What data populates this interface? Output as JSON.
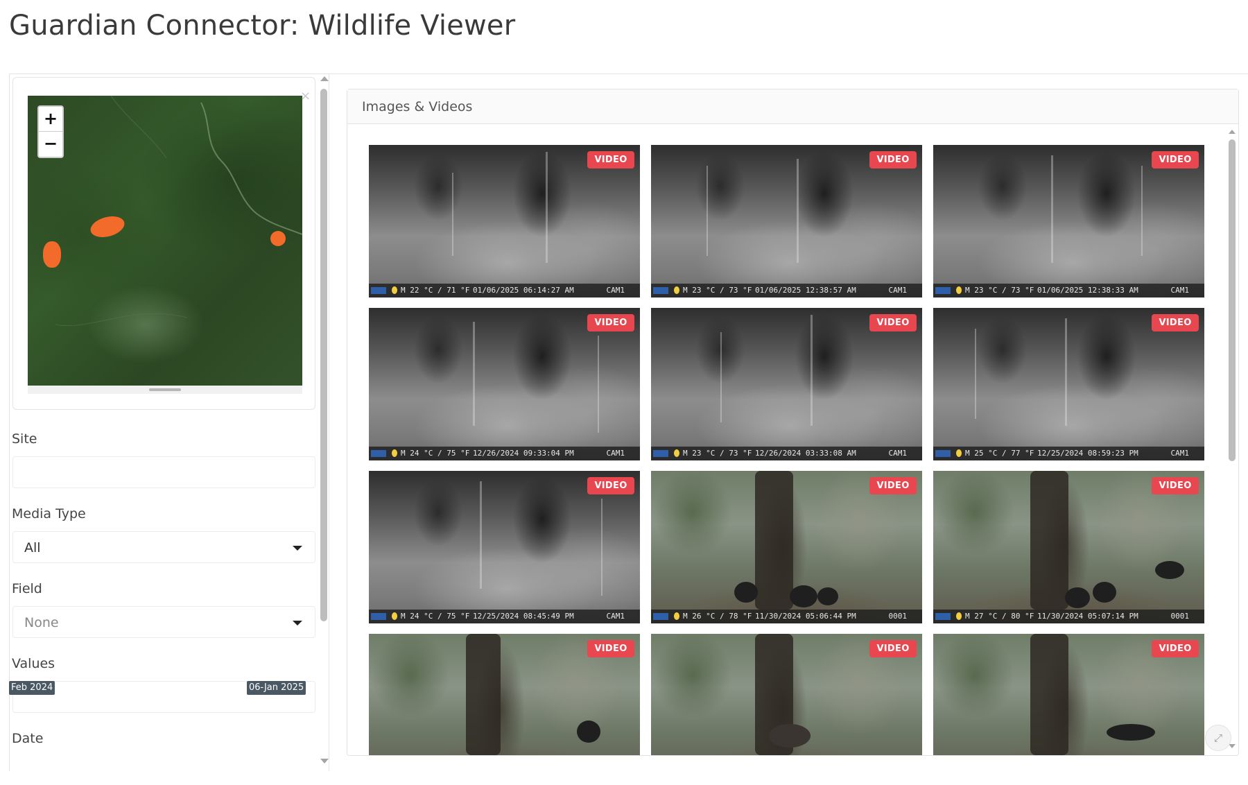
{
  "page": {
    "title": "Guardian Connector: Wildlife Viewer"
  },
  "map": {
    "zoom_in": "+",
    "zoom_out": "−",
    "close": "×",
    "marker_color": "#f26b2a"
  },
  "filters": {
    "site": {
      "label": "Site",
      "value": ""
    },
    "media_type": {
      "label": "Media Type",
      "value": "All"
    },
    "field": {
      "label": "Field",
      "value": "None"
    },
    "values": {
      "label": "Values",
      "value": ""
    },
    "date": {
      "label": "Date",
      "start": "Feb 2024",
      "end": "06-Jan 2025"
    }
  },
  "media": {
    "title": "Images & Videos",
    "badge_color": "#e8474f",
    "items": [
      {
        "badge": "VIDEO",
        "temp": "M 22 °C / 71 °F",
        "datetime": "01/06/2025 06:14:27 AM",
        "camera": "CAM1",
        "scene": "infrared"
      },
      {
        "badge": "VIDEO",
        "temp": "M 23 °C / 73 °F",
        "datetime": "01/06/2025 12:38:57 AM",
        "camera": "CAM1",
        "scene": "infrared"
      },
      {
        "badge": "VIDEO",
        "temp": "M 23 °C / 73 °F",
        "datetime": "01/06/2025 12:38:33 AM",
        "camera": "CAM1",
        "scene": "infrared"
      },
      {
        "badge": "VIDEO",
        "temp": "M 24 °C / 75 °F",
        "datetime": "12/26/2024 09:33:04 PM",
        "camera": "CAM1",
        "scene": "infrared"
      },
      {
        "badge": "VIDEO",
        "temp": "M 23 °C / 73 °F",
        "datetime": "12/26/2024 03:33:08 AM",
        "camera": "CAM1",
        "scene": "infrared"
      },
      {
        "badge": "VIDEO",
        "temp": "M 25 °C / 77 °F",
        "datetime": "12/25/2024 08:59:23 PM",
        "camera": "CAM1",
        "scene": "infrared"
      },
      {
        "badge": "VIDEO",
        "temp": "M 24 °C / 75 °F",
        "datetime": "12/25/2024 08:45:49 PM",
        "camera": "CAM1",
        "scene": "infrared"
      },
      {
        "badge": "VIDEO",
        "temp": "M 26 °C / 78 °F",
        "datetime": "11/30/2024 05:06:44 PM",
        "camera": "0001",
        "scene": "daylight"
      },
      {
        "badge": "VIDEO",
        "temp": "M 27 °C / 80 °F",
        "datetime": "11/30/2024 05:07:14 PM",
        "camera": "0001",
        "scene": "daylight"
      },
      {
        "badge": "VIDEO",
        "scene": "daylight"
      },
      {
        "badge": "VIDEO",
        "scene": "daylight"
      },
      {
        "badge": "VIDEO",
        "scene": "daylight"
      }
    ]
  },
  "icons": {
    "expand": "expand-icon",
    "caret": "caret-down-icon",
    "moon": "moon-icon",
    "camera_logo": "camera-brand-logo"
  }
}
